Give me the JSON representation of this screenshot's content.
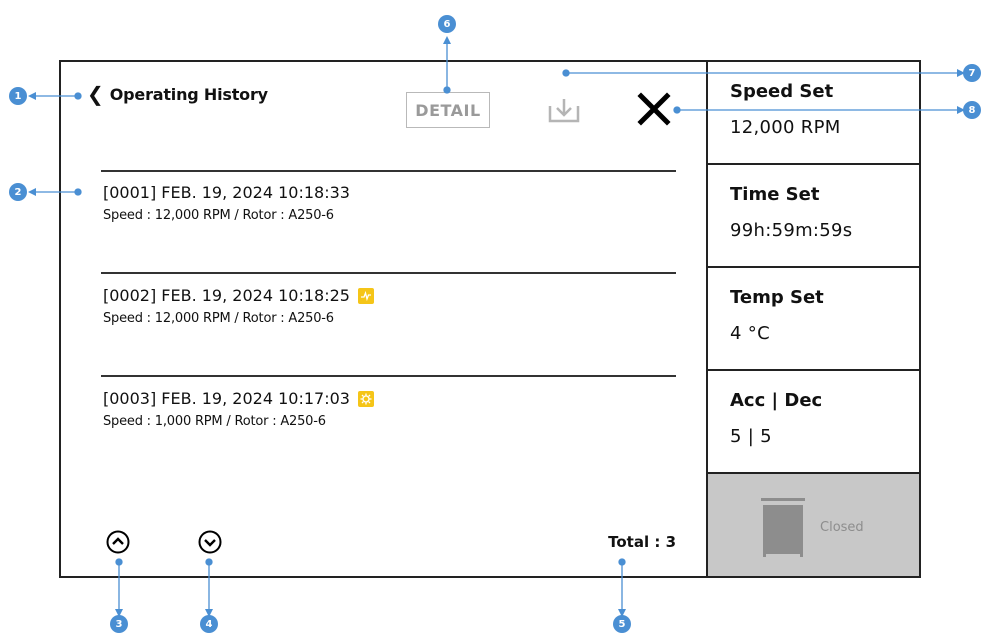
{
  "header": {
    "back_chevron": "❮",
    "title": "Operating History",
    "detail_label": "DETAIL",
    "download_icon": "download-icon",
    "close_icon": "close-icon"
  },
  "records": [
    {
      "head": "[0001] FEB. 19, 2024 10:18:33",
      "sub": "Speed : 12,000 RPM / Rotor : A250-6",
      "badge": null
    },
    {
      "head": "[0002] FEB. 19, 2024 10:18:25",
      "sub": "Speed : 12,000 RPM / Rotor : A250-6",
      "badge": "alarm-badge-icon"
    },
    {
      "head": "[0003] FEB. 19, 2024 10:17:03",
      "sub": "Speed : 1,000 RPM / Rotor : A250-6",
      "badge": "gear-badge-icon"
    }
  ],
  "footer": {
    "up_icon": "chevron-up-circle-icon",
    "down_icon": "chevron-down-circle-icon",
    "total": "Total : 3"
  },
  "side": {
    "speed": {
      "label": "Speed Set",
      "value": "12,000 RPM"
    },
    "time": {
      "label": "Time Set",
      "value": "99h:59m:59s"
    },
    "temp": {
      "label": "Temp Set",
      "value": "4 °C"
    },
    "accdec": {
      "label": "Acc | Dec",
      "value": "5 | 5"
    },
    "status": {
      "label": "Closed",
      "icon": "lid-closed-icon"
    }
  },
  "callouts": [
    "1",
    "2",
    "3",
    "4",
    "5",
    "6",
    "7",
    "8"
  ],
  "colors": {
    "accent": "#4a8fd3",
    "badge": "#f5c518",
    "status_bg": "#c8c8c8",
    "frame": "#222222"
  }
}
